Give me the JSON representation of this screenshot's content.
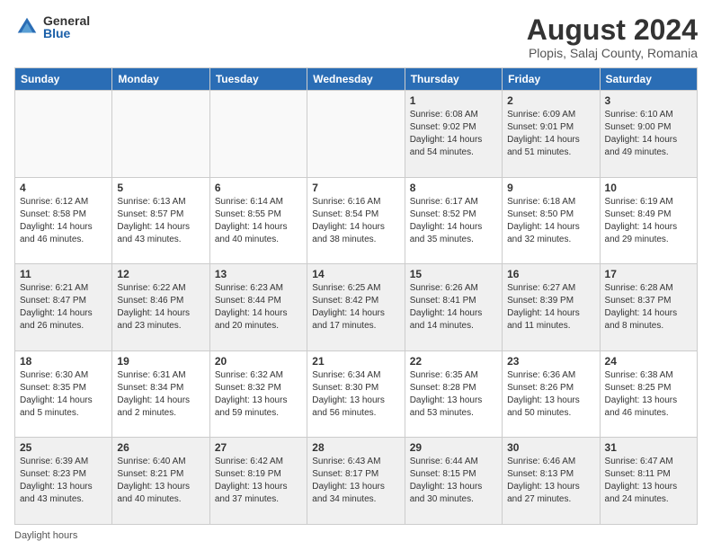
{
  "logo": {
    "general": "General",
    "blue": "Blue"
  },
  "title": "August 2024",
  "location": "Plopis, Salaj County, Romania",
  "days_header": [
    "Sunday",
    "Monday",
    "Tuesday",
    "Wednesday",
    "Thursday",
    "Friday",
    "Saturday"
  ],
  "footer": "Daylight hours",
  "weeks": [
    [
      {
        "num": "",
        "info": ""
      },
      {
        "num": "",
        "info": ""
      },
      {
        "num": "",
        "info": ""
      },
      {
        "num": "",
        "info": ""
      },
      {
        "num": "1",
        "info": "Sunrise: 6:08 AM\nSunset: 9:02 PM\nDaylight: 14 hours\nand 54 minutes."
      },
      {
        "num": "2",
        "info": "Sunrise: 6:09 AM\nSunset: 9:01 PM\nDaylight: 14 hours\nand 51 minutes."
      },
      {
        "num": "3",
        "info": "Sunrise: 6:10 AM\nSunset: 9:00 PM\nDaylight: 14 hours\nand 49 minutes."
      }
    ],
    [
      {
        "num": "4",
        "info": "Sunrise: 6:12 AM\nSunset: 8:58 PM\nDaylight: 14 hours\nand 46 minutes."
      },
      {
        "num": "5",
        "info": "Sunrise: 6:13 AM\nSunset: 8:57 PM\nDaylight: 14 hours\nand 43 minutes."
      },
      {
        "num": "6",
        "info": "Sunrise: 6:14 AM\nSunset: 8:55 PM\nDaylight: 14 hours\nand 40 minutes."
      },
      {
        "num": "7",
        "info": "Sunrise: 6:16 AM\nSunset: 8:54 PM\nDaylight: 14 hours\nand 38 minutes."
      },
      {
        "num": "8",
        "info": "Sunrise: 6:17 AM\nSunset: 8:52 PM\nDaylight: 14 hours\nand 35 minutes."
      },
      {
        "num": "9",
        "info": "Sunrise: 6:18 AM\nSunset: 8:50 PM\nDaylight: 14 hours\nand 32 minutes."
      },
      {
        "num": "10",
        "info": "Sunrise: 6:19 AM\nSunset: 8:49 PM\nDaylight: 14 hours\nand 29 minutes."
      }
    ],
    [
      {
        "num": "11",
        "info": "Sunrise: 6:21 AM\nSunset: 8:47 PM\nDaylight: 14 hours\nand 26 minutes."
      },
      {
        "num": "12",
        "info": "Sunrise: 6:22 AM\nSunset: 8:46 PM\nDaylight: 14 hours\nand 23 minutes."
      },
      {
        "num": "13",
        "info": "Sunrise: 6:23 AM\nSunset: 8:44 PM\nDaylight: 14 hours\nand 20 minutes."
      },
      {
        "num": "14",
        "info": "Sunrise: 6:25 AM\nSunset: 8:42 PM\nDaylight: 14 hours\nand 17 minutes."
      },
      {
        "num": "15",
        "info": "Sunrise: 6:26 AM\nSunset: 8:41 PM\nDaylight: 14 hours\nand 14 minutes."
      },
      {
        "num": "16",
        "info": "Sunrise: 6:27 AM\nSunset: 8:39 PM\nDaylight: 14 hours\nand 11 minutes."
      },
      {
        "num": "17",
        "info": "Sunrise: 6:28 AM\nSunset: 8:37 PM\nDaylight: 14 hours\nand 8 minutes."
      }
    ],
    [
      {
        "num": "18",
        "info": "Sunrise: 6:30 AM\nSunset: 8:35 PM\nDaylight: 14 hours\nand 5 minutes."
      },
      {
        "num": "19",
        "info": "Sunrise: 6:31 AM\nSunset: 8:34 PM\nDaylight: 14 hours\nand 2 minutes."
      },
      {
        "num": "20",
        "info": "Sunrise: 6:32 AM\nSunset: 8:32 PM\nDaylight: 13 hours\nand 59 minutes."
      },
      {
        "num": "21",
        "info": "Sunrise: 6:34 AM\nSunset: 8:30 PM\nDaylight: 13 hours\nand 56 minutes."
      },
      {
        "num": "22",
        "info": "Sunrise: 6:35 AM\nSunset: 8:28 PM\nDaylight: 13 hours\nand 53 minutes."
      },
      {
        "num": "23",
        "info": "Sunrise: 6:36 AM\nSunset: 8:26 PM\nDaylight: 13 hours\nand 50 minutes."
      },
      {
        "num": "24",
        "info": "Sunrise: 6:38 AM\nSunset: 8:25 PM\nDaylight: 13 hours\nand 46 minutes."
      }
    ],
    [
      {
        "num": "25",
        "info": "Sunrise: 6:39 AM\nSunset: 8:23 PM\nDaylight: 13 hours\nand 43 minutes."
      },
      {
        "num": "26",
        "info": "Sunrise: 6:40 AM\nSunset: 8:21 PM\nDaylight: 13 hours\nand 40 minutes."
      },
      {
        "num": "27",
        "info": "Sunrise: 6:42 AM\nSunset: 8:19 PM\nDaylight: 13 hours\nand 37 minutes."
      },
      {
        "num": "28",
        "info": "Sunrise: 6:43 AM\nSunset: 8:17 PM\nDaylight: 13 hours\nand 34 minutes."
      },
      {
        "num": "29",
        "info": "Sunrise: 6:44 AM\nSunset: 8:15 PM\nDaylight: 13 hours\nand 30 minutes."
      },
      {
        "num": "30",
        "info": "Sunrise: 6:46 AM\nSunset: 8:13 PM\nDaylight: 13 hours\nand 27 minutes."
      },
      {
        "num": "31",
        "info": "Sunrise: 6:47 AM\nSunset: 8:11 PM\nDaylight: 13 hours\nand 24 minutes."
      }
    ]
  ]
}
